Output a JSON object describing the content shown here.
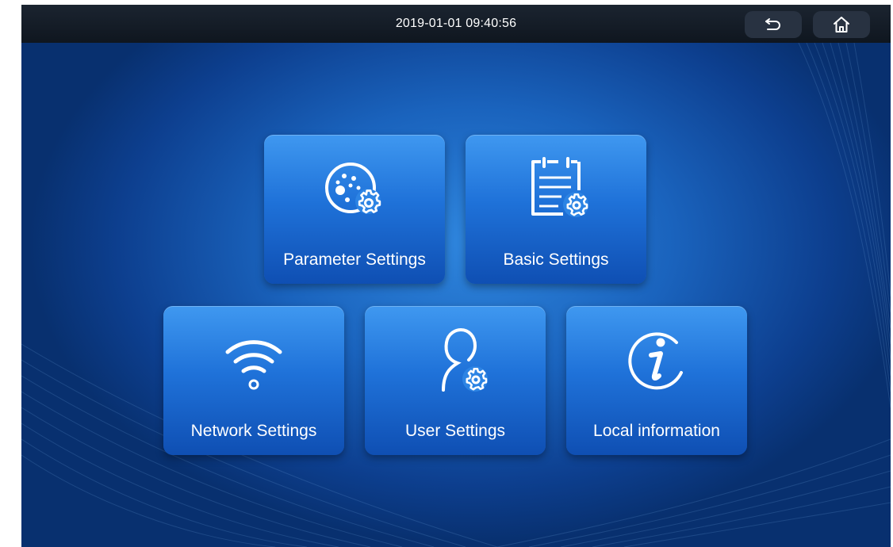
{
  "status_bar": {
    "datetime": "2019-01-01 09:40:56",
    "back_icon": "back-arrow-icon",
    "home_icon": "home-icon"
  },
  "menu": {
    "tiles": [
      {
        "label": "Parameter Settings",
        "icon": "parameter-gear-icon"
      },
      {
        "label": "Basic Settings",
        "icon": "clipboard-gear-icon"
      },
      {
        "label": "Network Settings",
        "icon": "wifi-icon"
      },
      {
        "label": "User Settings",
        "icon": "user-gear-icon"
      },
      {
        "label": "Local information",
        "icon": "info-icon"
      }
    ]
  },
  "colors": {
    "background": "#1a63bd",
    "tile": "#1f72d9",
    "top_bar": "#141c26"
  }
}
